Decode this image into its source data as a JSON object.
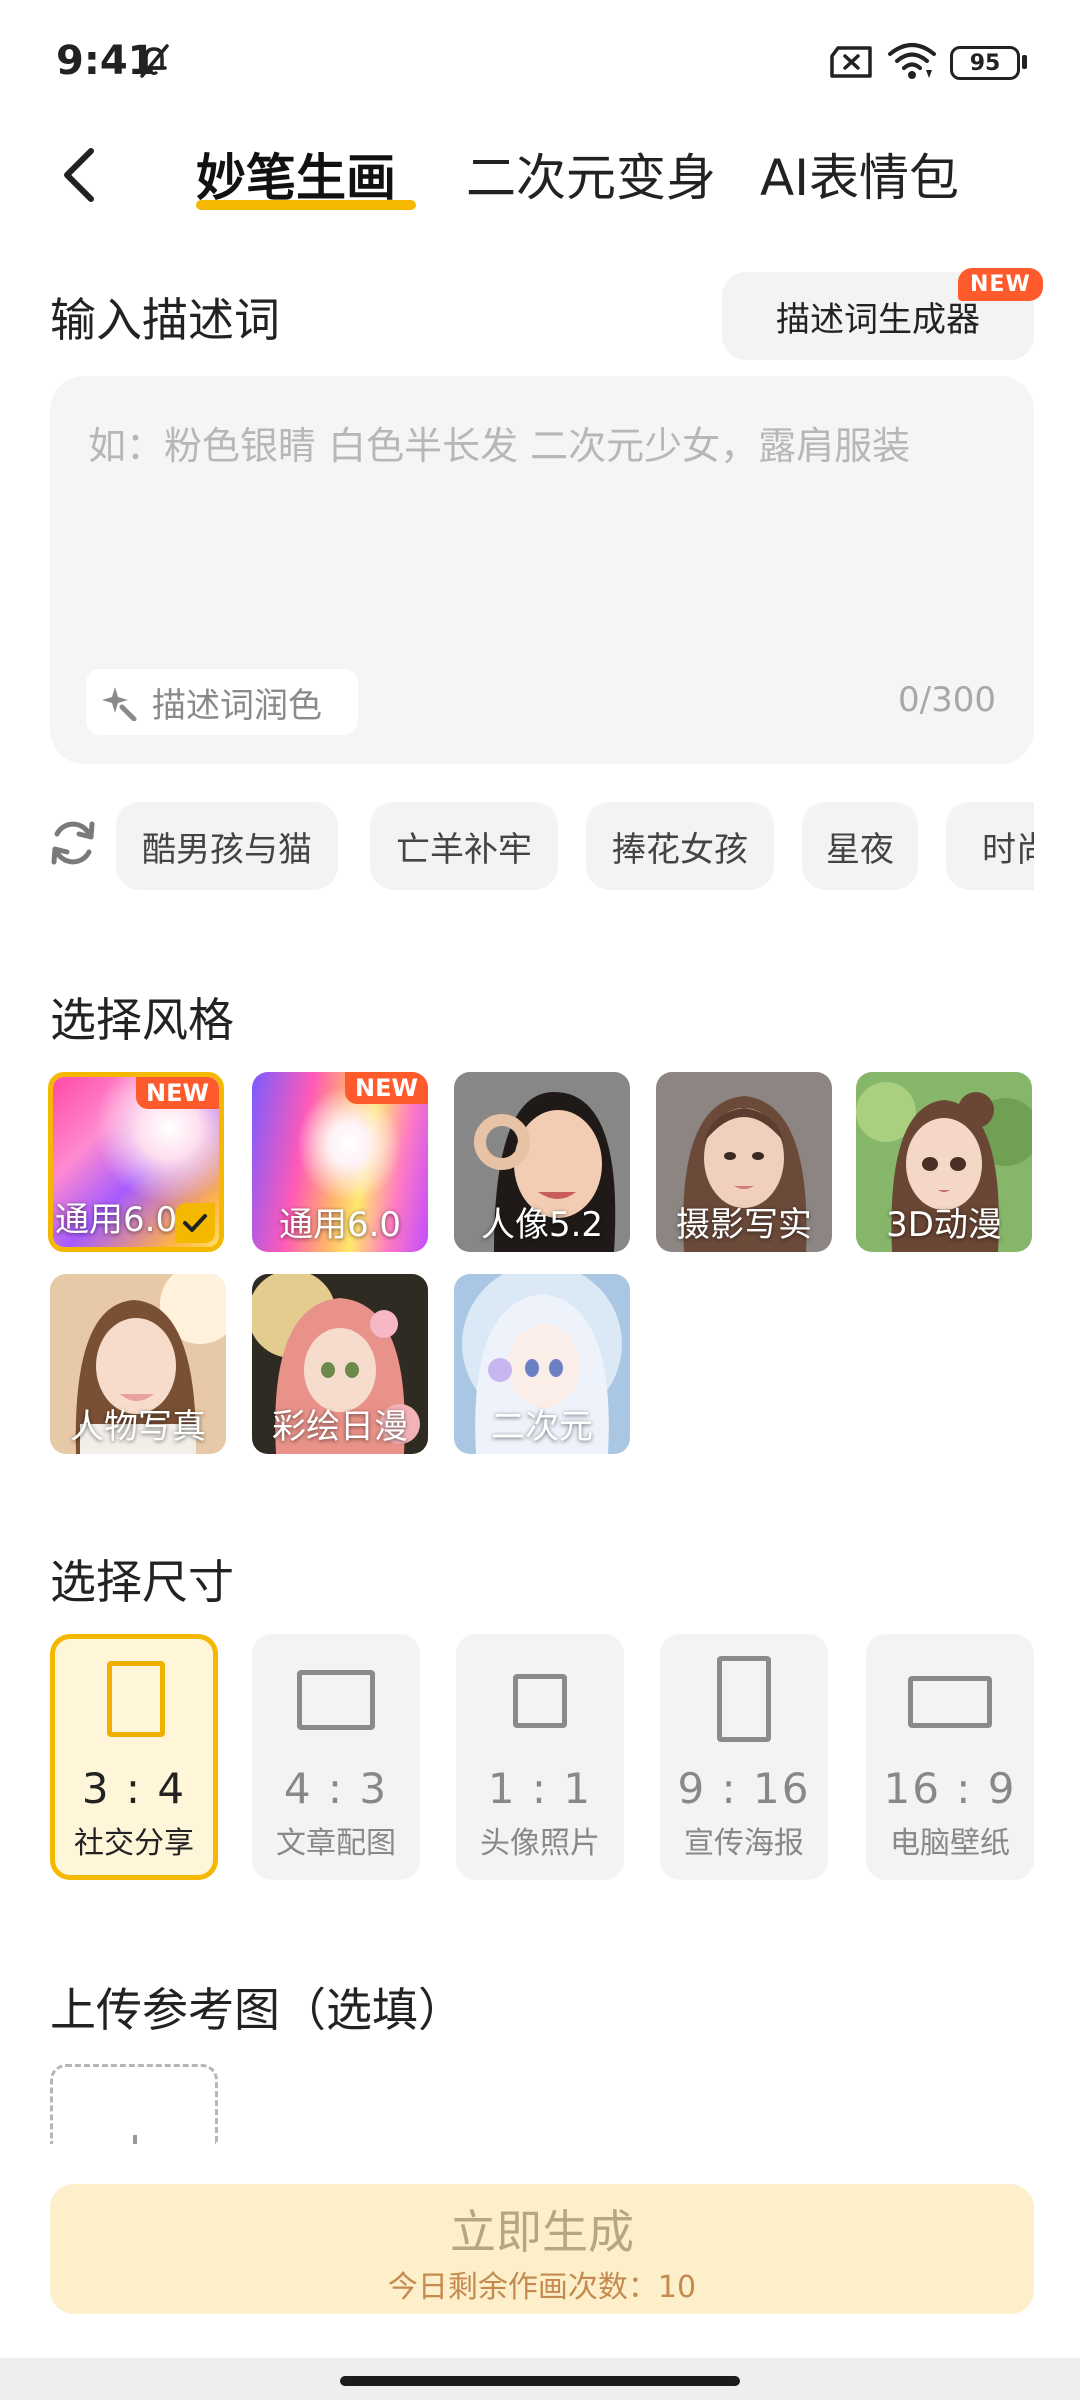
{
  "status_bar": {
    "time": "9:41",
    "battery": "95"
  },
  "header": {
    "tabs": [
      {
        "label": "妙笔生画",
        "active": true
      },
      {
        "label": "二次元变身",
        "active": false
      },
      {
        "label": "AI表情包",
        "active": false
      }
    ]
  },
  "prompt": {
    "section_title": "输入描述词",
    "generator_button": "描述词生成器",
    "new_badge": "NEW",
    "placeholder": "如：粉色银睛 白色半长发 二次元少女，露肩服装",
    "polish_button": "描述词润色",
    "counter": "0/300"
  },
  "suggestions": [
    "酷男孩与猫",
    "亡羊补牢",
    "捧花女孩",
    "星夜",
    "时尚"
  ],
  "styles": {
    "section_title": "选择风格",
    "items": [
      {
        "label": "通用6.0",
        "badge": "NEW",
        "selected": true
      },
      {
        "label": "通用6.0",
        "badge": "NEW",
        "selected": false
      },
      {
        "label": "人像5.2",
        "badge": "",
        "selected": false
      },
      {
        "label": "摄影写实",
        "badge": "",
        "selected": false
      },
      {
        "label": "3D动漫",
        "badge": "",
        "selected": false
      },
      {
        "label": "人物写真",
        "badge": "",
        "selected": false
      },
      {
        "label": "彩绘日漫",
        "badge": "",
        "selected": false
      },
      {
        "label": "二次元",
        "badge": "",
        "selected": false
      }
    ]
  },
  "sizes": {
    "section_title": "选择尺寸",
    "items": [
      {
        "ratio": "3 : 4",
        "desc": "社交分享",
        "selected": true
      },
      {
        "ratio": "4 : 3",
        "desc": "文章配图",
        "selected": false
      },
      {
        "ratio": "1 : 1",
        "desc": "头像照片",
        "selected": false
      },
      {
        "ratio": "9 : 16",
        "desc": "宣传海报",
        "selected": false
      },
      {
        "ratio": "16 : 9",
        "desc": "电脑壁纸",
        "selected": false
      }
    ]
  },
  "upload": {
    "section_title": "上传参考图（选填）"
  },
  "generate": {
    "label": "立即生成",
    "remaining": "今日剩余作画次数：10"
  },
  "colors": {
    "accent": "#f5b800",
    "badge": "#ff5a2c",
    "button_bg": "#fdefc9"
  }
}
